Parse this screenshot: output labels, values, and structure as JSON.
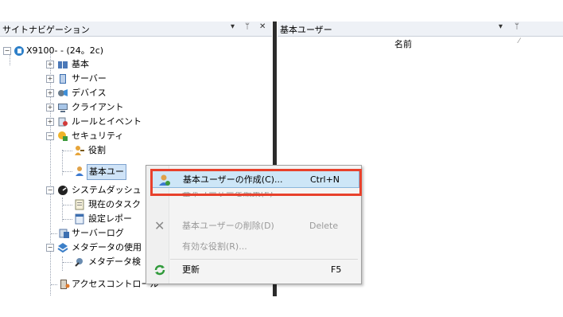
{
  "left_pane": {
    "title": "サイトナビゲーション",
    "pin_glyph": "▾ ⊥ ✕"
  },
  "right_pane": {
    "title": "基本ユーザー",
    "pin_glyph": "▾ ⊥",
    "column_name": "名前"
  },
  "tree": {
    "root": "X9100-          - (24。2c)",
    "items": [
      {
        "label": "基本",
        "icon": "book-icon"
      },
      {
        "label": "サーバー",
        "icon": "server-icon"
      },
      {
        "label": "デバイス",
        "icon": "devices-icon"
      },
      {
        "label": "クライアント",
        "icon": "client-icon"
      },
      {
        "label": "ルールとイベント",
        "icon": "rules-icon"
      },
      {
        "label": "セキュリティ",
        "icon": "security-icon"
      },
      {
        "label": "役割",
        "icon": "role-icon"
      },
      {
        "label": "基本ユー",
        "icon": "basic-user-icon"
      },
      {
        "label": "システムダッシュ",
        "icon": "dashboard-icon"
      },
      {
        "label": "現在のタスク",
        "icon": "task-icon"
      },
      {
        "label": "設定レポー",
        "icon": "report-icon"
      },
      {
        "label": "サーバーログ",
        "icon": "log-icon"
      },
      {
        "label": "メタデータの使用",
        "icon": "metadata-icon"
      },
      {
        "label": "メタデータ検",
        "icon": "metadata-search-icon"
      },
      {
        "label": "アクセスコントロール",
        "icon": "access-control-icon"
      }
    ]
  },
  "context_menu": {
    "items": [
      {
        "label": "基本ユーザーの作成(C)...",
        "shortcut": "Ctrl+N"
      },
      {
        "label": "基本ユーザーを編集(E)",
        "shortcut": ""
      },
      {
        "label": "基本ユーザーの削除(D)",
        "shortcut": "Delete"
      },
      {
        "label": "有効な役割(R)...",
        "shortcut": ""
      },
      {
        "label": "更新",
        "shortcut": "F5"
      }
    ]
  },
  "colors": {
    "highlight_border": "#e8412c",
    "selection_bg": "#cde6f7",
    "titlebar_bg": "#eef1f6"
  }
}
